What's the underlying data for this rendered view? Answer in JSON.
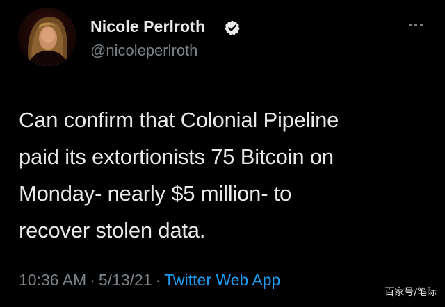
{
  "author": {
    "display_name": "Nicole Perlroth",
    "handle": "@nicoleperlroth",
    "verified": true,
    "avatar_icon": "profile-photo"
  },
  "tweet": {
    "text": "Can confirm that Colonial Pipeline\npaid its extortionists 75 Bitcoin on\nMonday- nearly $5 million- to\nrecover stolen data."
  },
  "meta": {
    "time": "10:36 AM",
    "separator": "·",
    "date": "5/13/21",
    "source": "Twitter Web App"
  },
  "watermark": "百家号/笔际",
  "colors": {
    "background": "#000000",
    "text": "#e7e9ea",
    "muted": "#7b8288",
    "accent": "#1d9bf0",
    "verified": "#e7e9ea"
  }
}
